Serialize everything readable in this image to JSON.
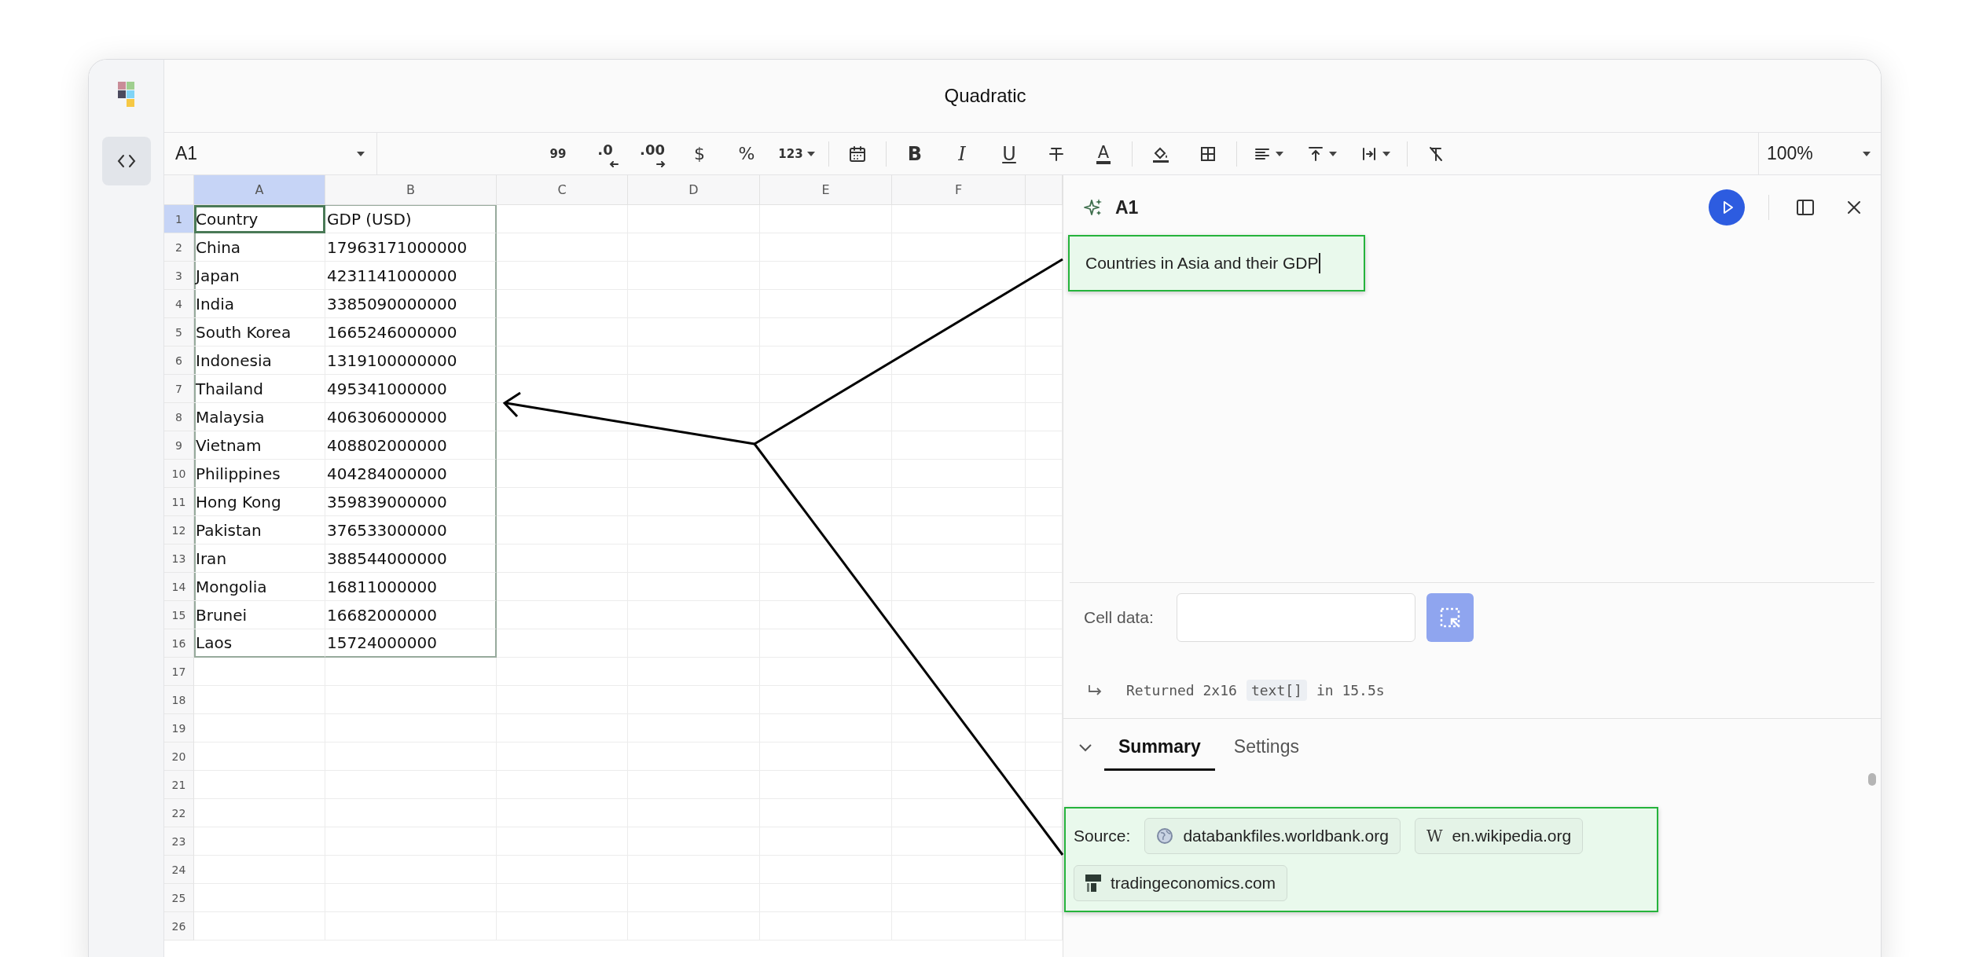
{
  "window": {
    "title": "Quadratic"
  },
  "toolbar": {
    "cell_reference": "A1",
    "text_tools": [
      "99",
      ".0",
      ".00",
      "$",
      "%",
      "123",
      "B",
      "I",
      "U",
      "A"
    ],
    "zoom": "100%"
  },
  "grid": {
    "columns": [
      {
        "label": "A",
        "selected": true
      },
      {
        "label": "B",
        "selected": false
      },
      {
        "label": "C",
        "selected": false
      },
      {
        "label": "D",
        "selected": false
      },
      {
        "label": "E",
        "selected": false
      },
      {
        "label": "F",
        "selected": false
      }
    ],
    "rows": [
      {
        "number": "1",
        "selected": true,
        "cells": [
          "Country",
          "GDP (USD)"
        ]
      },
      {
        "number": "2",
        "selected": false,
        "cells": [
          "China",
          "17963171000000"
        ]
      },
      {
        "number": "3",
        "selected": false,
        "cells": [
          "Japan",
          "4231141000000"
        ]
      },
      {
        "number": "4",
        "selected": false,
        "cells": [
          "India",
          "3385090000000"
        ]
      },
      {
        "number": "5",
        "selected": false,
        "cells": [
          "South Korea",
          "1665246000000"
        ]
      },
      {
        "number": "6",
        "selected": false,
        "cells": [
          "Indonesia",
          "1319100000000"
        ]
      },
      {
        "number": "7",
        "selected": false,
        "cells": [
          "Thailand",
          "495341000000"
        ]
      },
      {
        "number": "8",
        "selected": false,
        "cells": [
          "Malaysia",
          "406306000000"
        ]
      },
      {
        "number": "9",
        "selected": false,
        "cells": [
          "Vietnam",
          "408802000000"
        ]
      },
      {
        "number": "10",
        "selected": false,
        "cells": [
          "Philippines",
          "404284000000"
        ]
      },
      {
        "number": "11",
        "selected": false,
        "cells": [
          "Hong Kong",
          "359839000000"
        ]
      },
      {
        "number": "12",
        "selected": false,
        "cells": [
          "Pakistan",
          "376533000000"
        ]
      },
      {
        "number": "13",
        "selected": false,
        "cells": [
          "Iran",
          "388544000000"
        ]
      },
      {
        "number": "14",
        "selected": false,
        "cells": [
          "Mongolia",
          "16811000000"
        ]
      },
      {
        "number": "15",
        "selected": false,
        "cells": [
          "Brunei",
          "16682000000"
        ]
      },
      {
        "number": "16",
        "selected": false,
        "cells": [
          "Laos",
          "15724000000"
        ]
      },
      {
        "number": "17",
        "selected": false
      },
      {
        "number": "18",
        "selected": false
      },
      {
        "number": "19",
        "selected": false
      },
      {
        "number": "20",
        "selected": false
      },
      {
        "number": "21",
        "selected": false
      },
      {
        "number": "22",
        "selected": false
      },
      {
        "number": "23",
        "selected": false
      },
      {
        "number": "24",
        "selected": false
      },
      {
        "number": "25",
        "selected": false
      },
      {
        "number": "26",
        "selected": false
      }
    ]
  },
  "panel": {
    "cell": "A1",
    "prompt": "Countries in Asia and their GDP",
    "cell_data": {
      "label": "Cell data:"
    },
    "result": {
      "text": "Returned 2x16",
      "type": "text[]",
      "duration": "in 15.5s"
    },
    "tabs": [
      {
        "label": "Summary",
        "selected": true
      },
      {
        "label": "Settings",
        "selected": false
      }
    ],
    "sources": {
      "label": "Source:",
      "links": [
        {
          "label": "databankfiles.worldbank.org",
          "kind": "globe"
        },
        {
          "label": "en.wikipedia.org",
          "kind": "letter",
          "icon_text": "W"
        },
        {
          "label": "tradingeconomics.com",
          "kind": "blocks"
        }
      ]
    }
  }
}
